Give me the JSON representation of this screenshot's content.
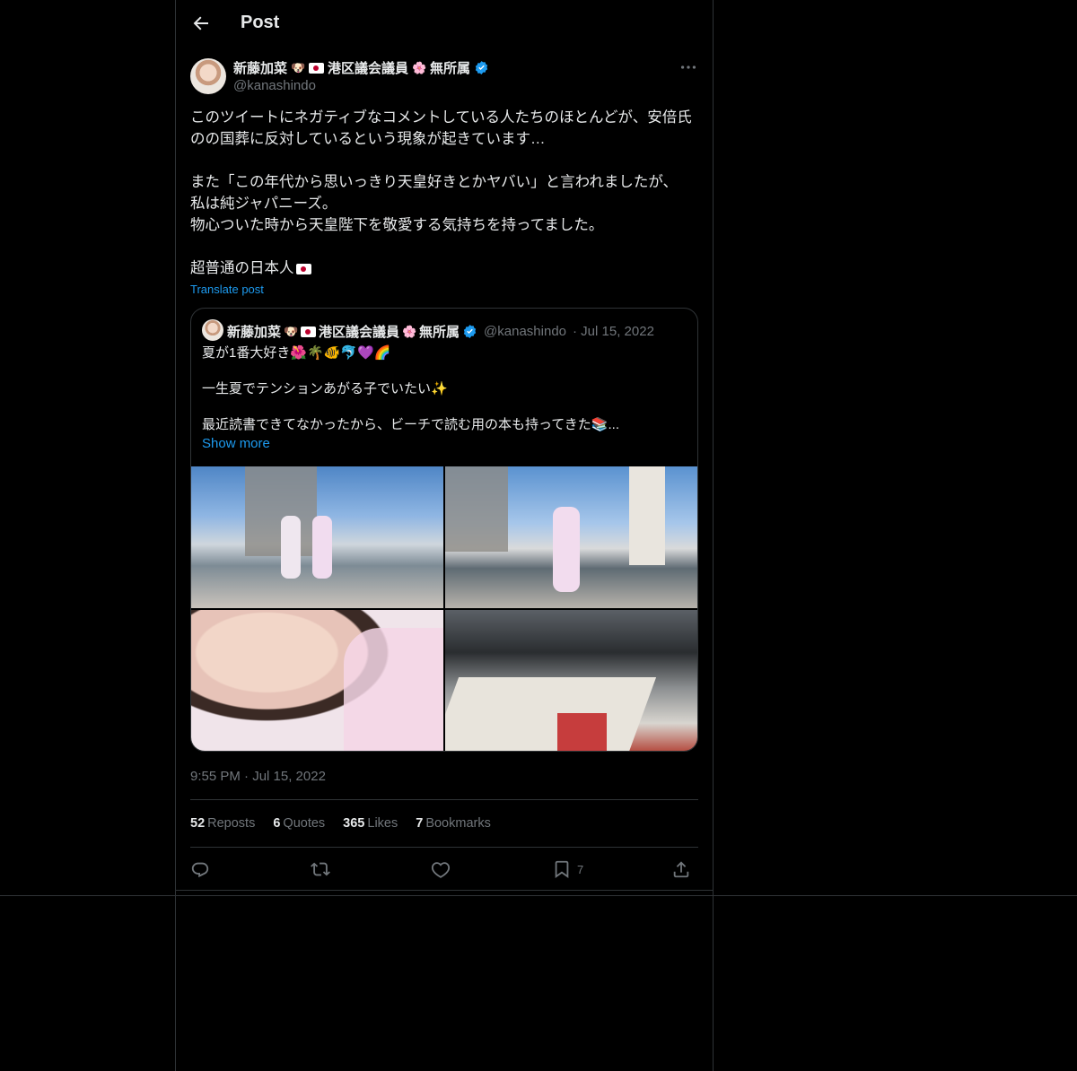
{
  "header": {
    "title": "Post"
  },
  "tweet": {
    "display_name": "新藤加菜",
    "name_suffix": "港区議会議員",
    "name_tail": "無所属",
    "handle": "@kanashindo",
    "text": "このツイートにネガティブなコメントしている人たちのほとんどが、安倍氏のの国葬に反対しているという現象が起きています…\n\nまた「この年代から思いっきり天皇好きとかヤバい」と言われましたが、\n私は純ジャパニーズ。\n物心ついた時から天皇陛下を敬愛する気持ちを持ってました。\n\n超普通の日本人",
    "translate": "Translate post",
    "timestamp": "9:55 PM · Jul 15, 2022"
  },
  "quote": {
    "display_name": "新藤加菜",
    "name_suffix": "港区議会議員",
    "name_tail": "無所属",
    "handle": "@kanashindo",
    "date": "· Jul 15, 2022",
    "line1": "夏が1番大好き🌺🌴🐠🐬💜🌈",
    "line2": "一生夏でテンションあがる子でいたい✨",
    "line3": "最近読書できてなかったから、ビーチで読む用の本も持ってきた📚...",
    "show_more": "Show more"
  },
  "stats": {
    "reposts_count": "52",
    "reposts_label": "Reposts",
    "quotes_count": "6",
    "quotes_label": "Quotes",
    "likes_count": "365",
    "likes_label": "Likes",
    "bookmarks_count": "7",
    "bookmarks_label": "Bookmarks"
  },
  "actions": {
    "bookmark_count": "7"
  },
  "colors": {
    "accent": "#1d9bf0",
    "muted": "#71767b",
    "border": "#2f3336",
    "background": "#000000"
  },
  "icons": [
    "back-arrow-icon",
    "verified-badge-icon",
    "more-icon",
    "reply-icon",
    "repost-icon",
    "like-icon",
    "bookmark-icon",
    "share-icon"
  ]
}
